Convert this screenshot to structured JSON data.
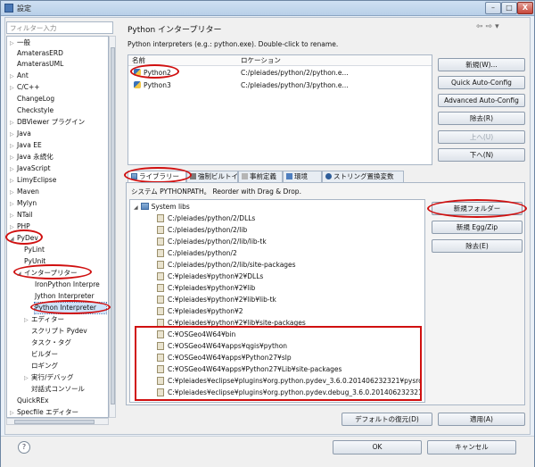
{
  "window": {
    "title": "設定"
  },
  "window_controls": {
    "minimize": "–",
    "maximize": "□",
    "close": "X"
  },
  "filter": {
    "placeholder": "フィルター入力"
  },
  "tree": {
    "items": [
      {
        "label": "一般",
        "arrow": "▷"
      },
      {
        "label": "AmaterasERD",
        "arrow": ""
      },
      {
        "label": "AmaterasUML",
        "arrow": ""
      },
      {
        "label": "Ant",
        "arrow": "▷"
      },
      {
        "label": "C/C++",
        "arrow": "▷"
      },
      {
        "label": "ChangeLog",
        "arrow": ""
      },
      {
        "label": "Checkstyle",
        "arrow": ""
      },
      {
        "label": "DBViewer プラグイン",
        "arrow": "▷"
      },
      {
        "label": "Java",
        "arrow": "▷"
      },
      {
        "label": "Java EE",
        "arrow": "▷"
      },
      {
        "label": "Java 永続化",
        "arrow": "▷"
      },
      {
        "label": "JavaScript",
        "arrow": "▷"
      },
      {
        "label": "LimyEclipse",
        "arrow": "▷"
      },
      {
        "label": "Maven",
        "arrow": "▷"
      },
      {
        "label": "Mylyn",
        "arrow": "▷"
      },
      {
        "label": "NTail",
        "arrow": "▷"
      },
      {
        "label": "PHP",
        "arrow": "▷"
      },
      {
        "label": "PyDev",
        "arrow": "◢"
      },
      {
        "label": "PyLint",
        "arrow": ""
      },
      {
        "label": "PyUnit",
        "arrow": ""
      },
      {
        "label": "インタープリター",
        "arrow": "◢"
      },
      {
        "label": "IronPython Interpre",
        "arrow": ""
      },
      {
        "label": "Jython Interpreter",
        "arrow": ""
      },
      {
        "label": "Python Interpreter",
        "arrow": ""
      },
      {
        "label": "エディター",
        "arrow": "▷"
      },
      {
        "label": "スクリプト Pydev",
        "arrow": ""
      },
      {
        "label": "タスク・タグ",
        "arrow": ""
      },
      {
        "label": "ビルダー",
        "arrow": ""
      },
      {
        "label": "ロギング",
        "arrow": ""
      },
      {
        "label": "実行/デバッグ",
        "arrow": "▷"
      },
      {
        "label": "対話式コンソール",
        "arrow": ""
      },
      {
        "label": "QuickREx",
        "arrow": ""
      },
      {
        "label": "Specfile エディター",
        "arrow": "▷"
      }
    ]
  },
  "page": {
    "title": "Python インタープリター",
    "subtitle": "Python interpreters (e.g.: python.exe).   Double-click to rename.",
    "nav_back": "⇦",
    "nav_forward": "⇨",
    "nav_menu": "▾"
  },
  "interpreters": {
    "col_name": "名前",
    "col_location": "ロケーション",
    "rows": [
      {
        "name": "Python2",
        "location": "C:/pleiades/python/2/python.e..."
      },
      {
        "name": "Python3",
        "location": "C:/pleiades/python/3/python.e..."
      }
    ]
  },
  "side_buttons": {
    "new": "新規(W)...",
    "quick": "Quick Auto-Config",
    "advanced": "Advanced Auto-Config",
    "remove": "除去(R)",
    "up": "上へ(U)",
    "down": "下へ(N)"
  },
  "tabs": {
    "libraries": "ライブラリー",
    "forced": "強制ビルトイン",
    "predef": "事前定義",
    "env": "環境",
    "strsub": "ストリング置換変数"
  },
  "lib_panel": {
    "header": "システム PYTHONPATH。  Reorder with Drag & Drop.",
    "root": "System libs",
    "paths": [
      "C:/pleiades/python/2/DLLs",
      "C:/pleiades/python/2/lib",
      "C:/pleiades/python/2/lib/lib-tk",
      "C:/pleiades/python/2",
      "C:/pleiades/python/2/lib/site-packages",
      "C:¥pleiades¥python¥2¥DLLs",
      "C:¥pleiades¥python¥2¥lib",
      "C:¥pleiades¥python¥2¥lib¥lib-tk",
      "C:¥pleiades¥python¥2",
      "C:¥pleiades¥python¥2¥lib¥site-packages",
      "C:¥OSGeo4W64¥bin",
      "C:¥OSGeo4W64¥apps¥qgis¥python",
      "C:¥OSGeo4W64¥apps¥Python27¥slp",
      "C:¥OSGeo4W64¥apps¥Python27¥Lib¥site-packages",
      "C:¥pleiades¥eclipse¥plugins¥org.python.pydev_3.6.0.201406232321¥pysrc",
      "C:¥pleiades¥eclipse¥plugins¥org.python.pydev.debug_3.6.0.201406232321"
    ]
  },
  "lib_buttons": {
    "new_folder": "新規フォルダー",
    "new_egg": "新規 Egg/Zip",
    "remove": "除去(E)"
  },
  "bottom": {
    "restore": "デフォルトの復元(D)",
    "apply": "適用(A)",
    "ok": "OK",
    "cancel": "キャンセル",
    "help": "?"
  }
}
